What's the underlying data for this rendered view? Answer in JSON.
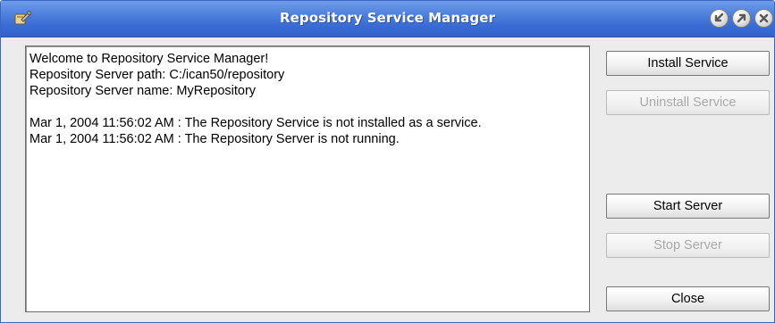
{
  "window": {
    "title": "Repository Service Manager",
    "titlebar_color": "#3a6bd4",
    "icons": {
      "app": "app-tool-icon",
      "minimize": "minimize-arrow-icon",
      "maximize": "maximize-arrow-icon",
      "close": "close-x-icon"
    }
  },
  "log": {
    "lines": [
      "Welcome to Repository Service Manager!",
      "Repository Server path: C:/ican50/repository",
      "Repository Server name: MyRepository",
      "",
      "Mar 1, 2004 11:56:02 AM : The Repository Service is not installed as a service.",
      "Mar 1, 2004 11:56:02 AM : The Repository Server is not running."
    ]
  },
  "buttons": {
    "install_service": {
      "label": "Install Service",
      "enabled": true
    },
    "uninstall_service": {
      "label": "Uninstall Service",
      "enabled": false
    },
    "start_server": {
      "label": "Start Server",
      "enabled": true
    },
    "stop_server": {
      "label": "Stop Server",
      "enabled": false
    },
    "close": {
      "label": "Close",
      "enabled": true
    }
  }
}
